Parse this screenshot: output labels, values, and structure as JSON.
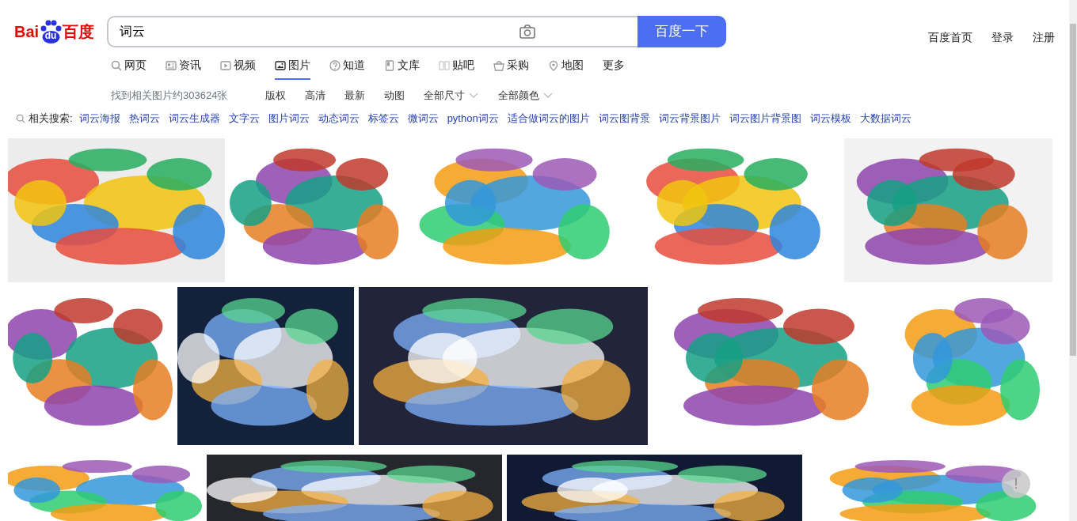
{
  "logo": {
    "left": "Bai",
    "paw": "du",
    "right": "百度"
  },
  "search": {
    "value": "词云",
    "button": "百度一下"
  },
  "top_links": [
    "百度首页",
    "登录",
    "注册"
  ],
  "tabs": [
    {
      "label": "网页",
      "selected": false
    },
    {
      "label": "资讯",
      "selected": false
    },
    {
      "label": "视频",
      "selected": false
    },
    {
      "label": "图片",
      "selected": true
    },
    {
      "label": "知道",
      "selected": false
    },
    {
      "label": "文库",
      "selected": false
    },
    {
      "label": "贴吧",
      "selected": false
    },
    {
      "label": "采购",
      "selected": false
    },
    {
      "label": "地图",
      "selected": false
    },
    {
      "label": "更多",
      "selected": false
    }
  ],
  "result_count": "找到相关图片约303624张",
  "filters": [
    {
      "label": "版权",
      "kind": "link"
    },
    {
      "label": "高清",
      "kind": "link"
    },
    {
      "label": "最新",
      "kind": "link"
    },
    {
      "label": "动图",
      "kind": "link"
    },
    {
      "label": "全部尺寸",
      "kind": "dropdown"
    },
    {
      "label": "全部颜色",
      "kind": "dropdown"
    }
  ],
  "related": {
    "label": "相关搜索:",
    "items": [
      "词云海报",
      "热词云",
      "词云生成器",
      "文字云",
      "图片词云",
      "动态词云",
      "标签云",
      "微词云",
      "python词云",
      "适合做词云的图片",
      "词云图背景",
      "词云背景图片",
      "词云图片背景图",
      "词云模板",
      "大数据词云"
    ]
  },
  "image_rows": [
    {
      "images": [
        {
          "kind": "picture"
        },
        {
          "kind": "picture"
        },
        {
          "kind": "picture"
        },
        {
          "kind": "picture"
        },
        {
          "kind": "picture"
        }
      ]
    },
    {
      "images": [
        {
          "kind": "picture"
        },
        {
          "kind": "picture"
        },
        {
          "kind": "picture"
        },
        {
          "kind": "picture"
        },
        {
          "kind": "picture"
        }
      ]
    },
    {
      "images": [
        {
          "kind": "picture"
        },
        {
          "kind": "picture"
        },
        {
          "kind": "picture"
        },
        {
          "kind": "picture"
        }
      ]
    }
  ],
  "feedback_button": "!"
}
